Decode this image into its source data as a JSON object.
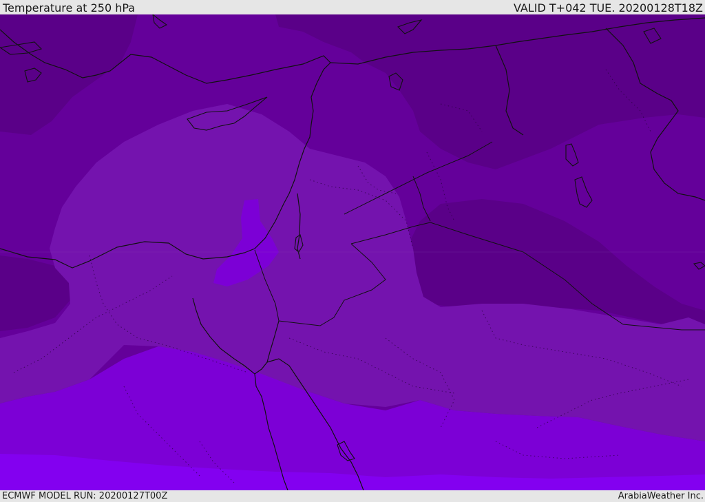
{
  "header": {
    "title": "Temperature at 250 hPa",
    "valid": "VALID T+042 TUE. 20200128T18Z"
  },
  "footer": {
    "model_run": "ECMWF MODEL RUN: 20200127T00Z",
    "credit": "ArabiaWeather Inc."
  },
  "map": {
    "field": "temperature",
    "level": "250 hPa",
    "region": "Eastern Mediterranean / Middle East",
    "colors": {
      "coldest": "#4e0077",
      "cold": "#5a0088",
      "cool": "#64009a",
      "mid": "#7413ae",
      "warm": "#7c00d6",
      "warmer": "#8300f0",
      "warmest": "#7c00fb",
      "coast": "#111111"
    }
  }
}
